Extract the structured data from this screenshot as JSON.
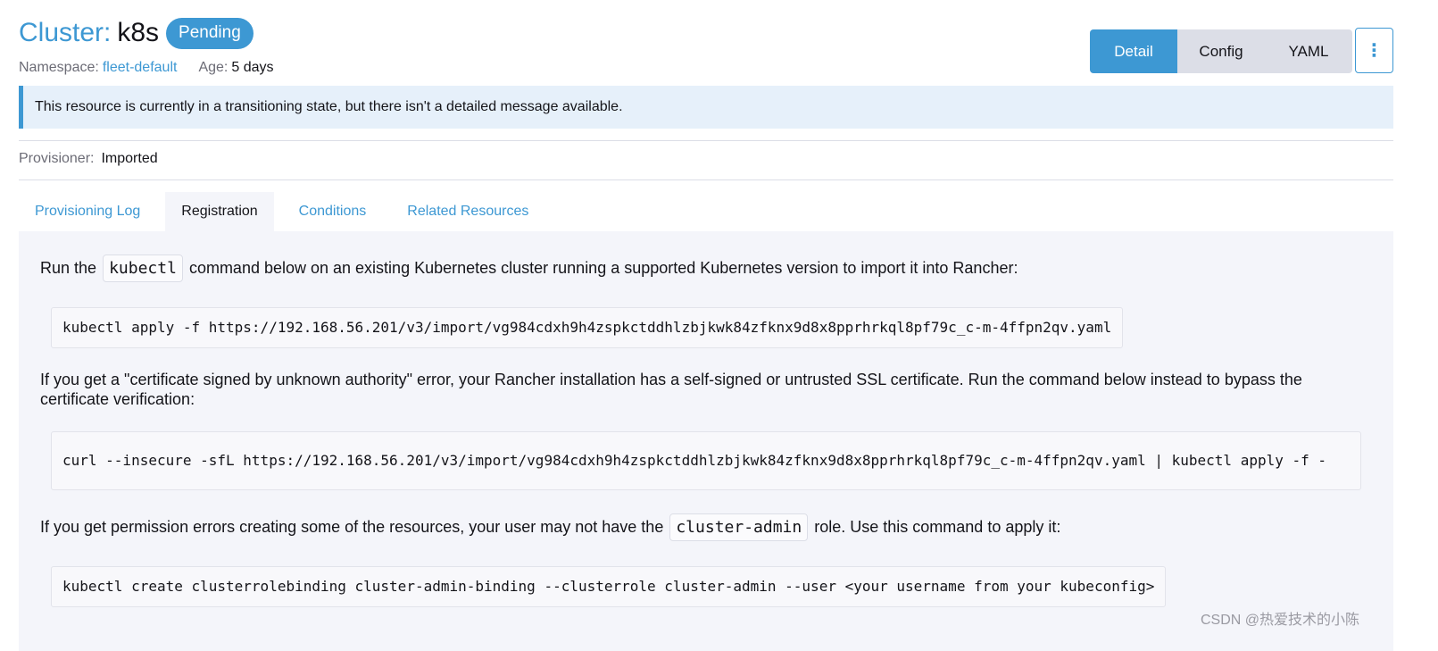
{
  "header": {
    "title_prefix": "Cluster:",
    "title_name": "k8s",
    "status": "Pending",
    "namespace_label": "Namespace:",
    "namespace_value": "fleet-default",
    "age_label": "Age:",
    "age_value": "5 days"
  },
  "view_toggle": {
    "detail": "Detail",
    "config": "Config",
    "yaml": "YAML",
    "active": "Detail"
  },
  "more_icon": "⋮",
  "banner": {
    "message": "This resource is currently in a transitioning state, but there isn't a detailed message available."
  },
  "provisioner": {
    "label": "Provisioner:",
    "value": "Imported"
  },
  "tabs": [
    {
      "label": "Provisioning Log"
    },
    {
      "label": "Registration"
    },
    {
      "label": "Conditions"
    },
    {
      "label": "Related Resources"
    }
  ],
  "active_tab": "Registration",
  "registration": {
    "p1_before": "Run the",
    "p1_code": "kubectl",
    "p1_after": "command below on an existing Kubernetes cluster running a supported Kubernetes version to import it into Rancher:",
    "cmd1": "kubectl apply -f https://192.168.56.201/v3/import/vg984cdxh9h4zspkctddhlzbjkwk84zfknx9d8x8pprhrkql8pf79c_c-m-4ffpn2qv.yaml",
    "p2": "If you get a \"certificate signed by unknown authority\" error, your Rancher installation has a self-signed or untrusted SSL certificate. Run the command below instead to bypass the certificate verification:",
    "cmd2": "curl --insecure -sfL https://192.168.56.201/v3/import/vg984cdxh9h4zspkctddhlzbjkwk84zfknx9d8x8pprhrkql8pf79c_c-m-4ffpn2qv.yaml | kubectl apply -f -",
    "p3_before": "If you get permission errors creating some of the resources, your user may not have the",
    "p3_code": "cluster-admin",
    "p3_after": "role. Use this command to apply it:",
    "cmd3": "kubectl create clusterrolebinding cluster-admin-binding --clusterrole cluster-admin --user <your username from your kubeconfig>"
  },
  "watermark": "CSDN @热爱技术的小陈",
  "colors": {
    "accent": "#3d98d3",
    "banner_bg": "#e6f0fa",
    "panel_bg": "#f4f5fa"
  }
}
